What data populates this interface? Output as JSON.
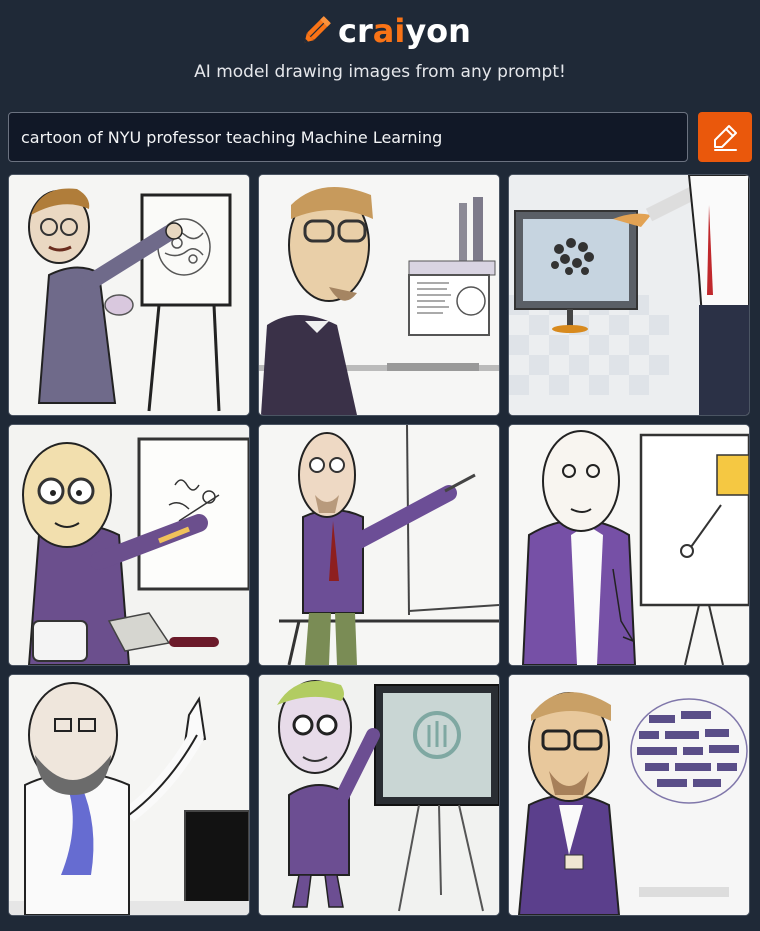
{
  "header": {
    "logo_prefix": "cr",
    "logo_accent": "ai",
    "logo_suffix": "yon",
    "tagline": "AI model drawing images from any prompt!"
  },
  "search": {
    "value": "cartoon of NYU professor teaching Machine Learning",
    "button_icon": "pencil-icon"
  },
  "colors": {
    "background": "#1f2937",
    "accent": "#ea580c",
    "input_bg": "#111827",
    "border": "#4b5563"
  },
  "images": [
    {
      "subject": "professor pointing at brain diagram on easel"
    },
    {
      "subject": "professor with glasses and computer monitor"
    },
    {
      "subject": "monitor with neural network and pointing hand"
    },
    {
      "subject": "bald professor drawing on whiteboard"
    },
    {
      "subject": "professor in purple jacket pointing at board"
    },
    {
      "subject": "professor standing by whiteboard with sticky note"
    },
    {
      "subject": "bearded professor next to screen"
    },
    {
      "subject": "green-haired professor with easel screen"
    },
    {
      "subject": "professor with word-cloud brain"
    }
  ]
}
